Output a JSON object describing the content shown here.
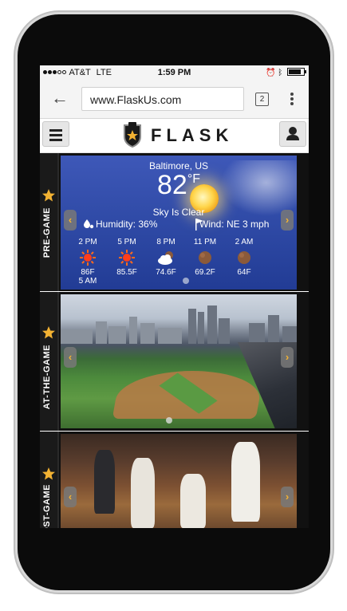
{
  "status": {
    "carrier": "AT&T",
    "network": "LTE",
    "time": "1:59 PM"
  },
  "browser": {
    "url": "www.FlaskUs.com",
    "tab_count": "2"
  },
  "app": {
    "logo_text": "FLASK"
  },
  "sections": [
    {
      "label": "PRE-GAME"
    },
    {
      "label": "AT-THE-GAME"
    },
    {
      "label": "POST-GAME"
    }
  ],
  "weather": {
    "city": "Baltimore, US",
    "temp": "82",
    "unit": "°F",
    "condition": "Sky Is Clear",
    "humidity": "Humidity: 36%",
    "wind": "Wind: NE 3 mph",
    "forecast": [
      {
        "time": "2 PM",
        "temp": "86F",
        "icon": "sun-icon"
      },
      {
        "time": "5 PM",
        "temp": "85.5F",
        "icon": "sun-icon"
      },
      {
        "time": "8 PM",
        "temp": "74.6F",
        "icon": "cloud-moon-icon"
      },
      {
        "time": "11 PM",
        "temp": "69.2F",
        "icon": "moon-icon"
      },
      {
        "time": "2 AM",
        "temp": "64F",
        "icon": "moon-icon"
      }
    ],
    "extra_time": "5 AM"
  },
  "colors": {
    "accent": "#f2b233",
    "weather_bg": "#2f4aa6",
    "sidebar": "#1a1a1a"
  }
}
